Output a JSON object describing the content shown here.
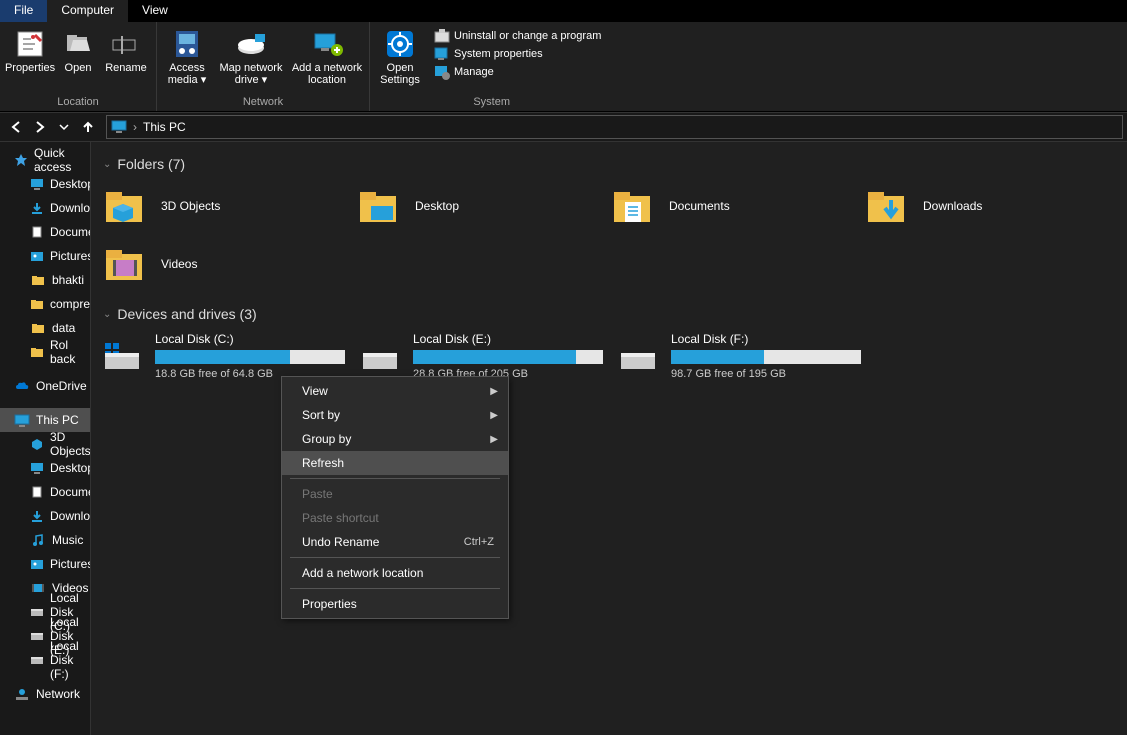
{
  "menubar": {
    "file": "File",
    "computer": "Computer",
    "view": "View"
  },
  "ribbon": {
    "location": {
      "properties": "Properties",
      "open": "Open",
      "rename": "Rename",
      "group": "Location"
    },
    "network": {
      "access_media": "Access media ▾",
      "map_drive": "Map network drive ▾",
      "add_location": "Add a network location",
      "group": "Network"
    },
    "system": {
      "open_settings": "Open Settings",
      "uninstall": "Uninstall or change a program",
      "sysprops": "System properties",
      "manage": "Manage",
      "group": "System"
    }
  },
  "addressbar": {
    "location": "This PC"
  },
  "sidebar": {
    "quick_access": "Quick access",
    "desktop": "Desktop",
    "downloads": "Downloads",
    "documents": "Documents",
    "pictures": "Pictures",
    "bhakti": "bhakti",
    "compressjpeg": "compressjpeg",
    "data": "data",
    "rollback": "Rol back",
    "onedrive": "OneDrive",
    "thispc": "This PC",
    "tp_3d": "3D Objects",
    "tp_desktop": "Desktop",
    "tp_documents": "Documents",
    "tp_downloads": "Downloads",
    "tp_music": "Music",
    "tp_pictures": "Pictures",
    "tp_videos": "Videos",
    "tp_c": "Local Disk (C:)",
    "tp_e": "Local Disk (E:)",
    "tp_f": "Local Disk (F:)",
    "network": "Network"
  },
  "content": {
    "folders_header": "Folders (7)",
    "drives_header": "Devices and drives (3)",
    "folders": {
      "threed": "3D Objects",
      "desktop": "Desktop",
      "documents": "Documents",
      "downloads": "Downloads",
      "videos": "Videos"
    },
    "drives": {
      "c": {
        "name": "Local Disk (C:)",
        "free": "18.8 GB free of 64.8 GB",
        "fill": 71
      },
      "e": {
        "name": "Local Disk (E:)",
        "free": "28.8 GB free of 205 GB",
        "fill": 86
      },
      "f": {
        "name": "Local Disk (F:)",
        "free": "98.7 GB free of 195 GB",
        "fill": 49
      }
    }
  },
  "contextmenu": {
    "view": "View",
    "sortby": "Sort by",
    "groupby": "Group by",
    "refresh": "Refresh",
    "paste": "Paste",
    "paste_shortcut": "Paste shortcut",
    "undo_rename": "Undo Rename",
    "undo_shortcut": "Ctrl+Z",
    "add_network": "Add a network location",
    "properties": "Properties"
  }
}
